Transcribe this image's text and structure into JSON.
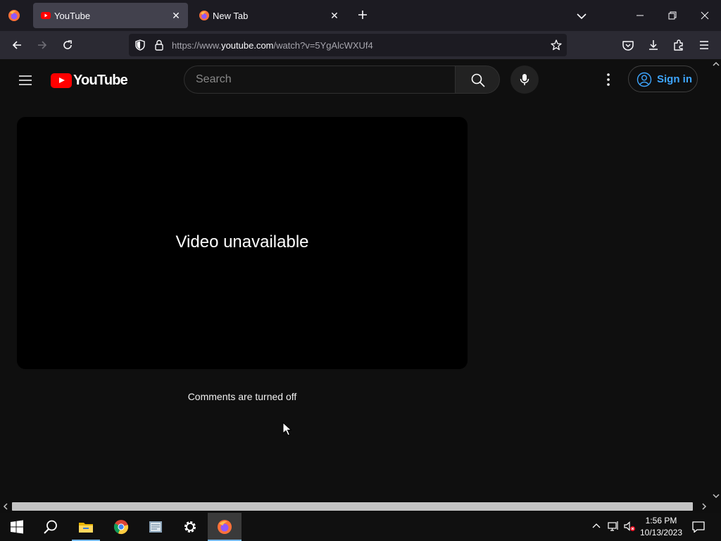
{
  "browser": {
    "tabs": [
      {
        "title": "YouTube",
        "favicon": "youtube-icon",
        "active": true
      },
      {
        "title": "New Tab",
        "favicon": "firefox-icon",
        "active": false
      }
    ],
    "url": {
      "scheme": "https://www.",
      "host": "youtube.com",
      "path": "/watch?v=5YgAlcWXUf4"
    }
  },
  "youtube": {
    "logo_text": "YouTube",
    "search_placeholder": "Search",
    "sign_in_label": "Sign in",
    "player_message": "Video unavailable",
    "comments_status": "Comments are turned off"
  },
  "taskbar": {
    "apps": [
      "start-icon",
      "search-icon",
      "file-explorer-icon",
      "chrome-icon",
      "documents-icon",
      "settings-icon",
      "firefox-icon"
    ],
    "time": "1:56 PM",
    "date": "10/13/2023"
  },
  "colors": {
    "youtube_red": "#ff0000",
    "link_blue": "#3ea6ff",
    "page_bg": "#0f0f0f"
  }
}
